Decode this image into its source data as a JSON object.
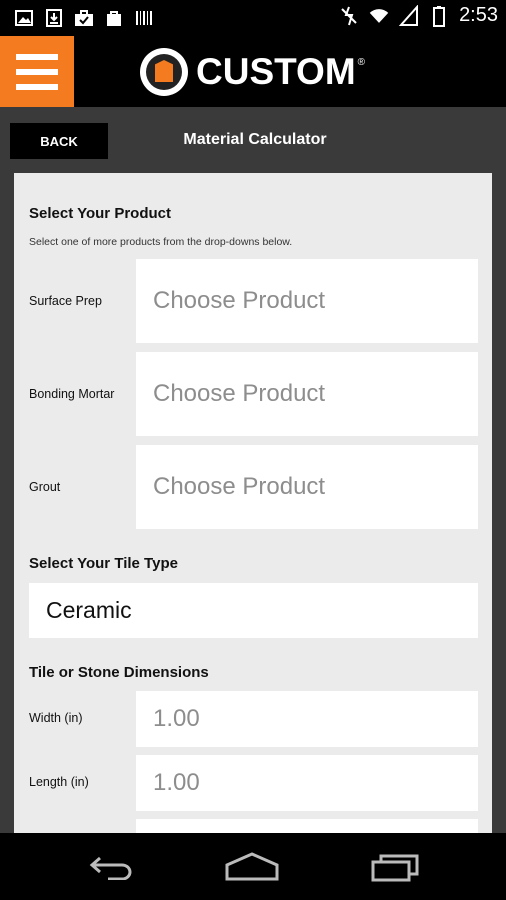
{
  "status_bar": {
    "time": "2:53",
    "left_icons": [
      "gallery-icon",
      "download-icon",
      "briefcase-check-icon",
      "bag-icon",
      "barcode-icon"
    ],
    "right_icons": [
      "signal-off-icon",
      "wifi-icon",
      "cell-signal-icon",
      "battery-icon"
    ]
  },
  "header": {
    "logo_text": "CUSTOM",
    "logo_reg": "®",
    "accent_color": "#f47b20"
  },
  "subheader": {
    "back_label": "BACK",
    "title": "Material Calculator"
  },
  "form": {
    "product_section_title": "Select Your Product",
    "product_section_hint": "Select one of more products from the drop-downs below.",
    "products": [
      {
        "label": "Surface Prep",
        "value": "Choose Product"
      },
      {
        "label": "Bonding Mortar",
        "value": "Choose Product"
      },
      {
        "label": "Grout",
        "value": "Choose Product"
      }
    ],
    "tile_type_title": "Select Your Tile Type",
    "tile_type_value": "Ceramic",
    "dimensions_title": "Tile or Stone Dimensions",
    "dimensions": [
      {
        "label": "Width (in)",
        "value": "1.00"
      },
      {
        "label": "Length (in)",
        "value": "1.00"
      }
    ]
  },
  "nav": {
    "icons": [
      "back-nav-icon",
      "home-nav-icon",
      "recents-nav-icon"
    ]
  }
}
